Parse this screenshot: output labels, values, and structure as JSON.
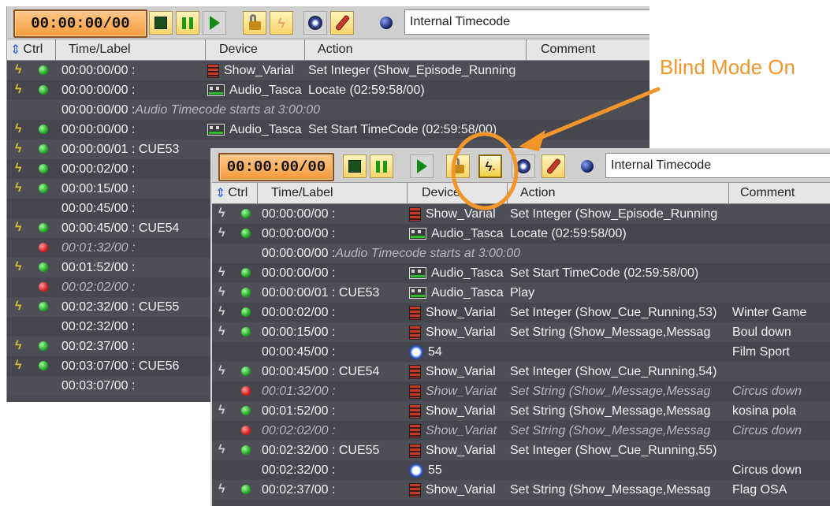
{
  "annotation": {
    "text": "Blind Mode On",
    "color": "#f2962a"
  },
  "toolbar": {
    "timecode": "00:00:00/00",
    "source": "Internal Timecode",
    "icons": [
      "stop-icon",
      "pause-icon",
      "play-icon",
      "lock-icon",
      "blind-mode-icon",
      "mixer-icon",
      "wrench-icon",
      "source-ball-icon"
    ]
  },
  "columns": {
    "ctrl": "Ctrl",
    "time": "Time/Label",
    "device": "Device",
    "action": "Action",
    "comment": "Comment"
  },
  "back_window": {
    "blind_mode": false,
    "rows": [
      {
        "bolt": true,
        "dot": "green",
        "time": "00:00:00/00 :",
        "icon": "show",
        "device": "Show_Varial",
        "action": "Set Integer (Show_Episode_Running",
        "comment": ""
      },
      {
        "bolt": true,
        "dot": "green",
        "time": "00:00:00/00 :",
        "icon": "audio",
        "device": "Audio_Tasca",
        "action": "Locate (02:59:58/00)",
        "comment": ""
      },
      {
        "bolt": false,
        "dot": "",
        "time": "00:00:00/00 : Audio Timecode starts at 3:00:00",
        "icon": "",
        "device": "",
        "action": "",
        "comment": "",
        "note": true
      },
      {
        "bolt": true,
        "dot": "green",
        "time": "00:00:00/00 :",
        "icon": "audio",
        "device": "Audio_Tasca",
        "action": "Set Start TimeCode (02:59:58/00)",
        "comment": ""
      },
      {
        "bolt": true,
        "dot": "green",
        "time": "00:00:00/01 : CUE53",
        "icon": "",
        "device": "",
        "action": "",
        "comment": ""
      },
      {
        "bolt": true,
        "dot": "green",
        "time": "00:00:02/00 :",
        "icon": "",
        "device": "",
        "action": "",
        "comment": ""
      },
      {
        "bolt": true,
        "dot": "green",
        "time": "00:00:15/00 :",
        "icon": "",
        "device": "",
        "action": "",
        "comment": ""
      },
      {
        "bolt": false,
        "dot": "",
        "time": "00:00:45/00 :",
        "icon": "",
        "device": "",
        "action": "",
        "comment": ""
      },
      {
        "bolt": true,
        "dot": "green",
        "time": "00:00:45/00 : CUE54",
        "icon": "",
        "device": "",
        "action": "",
        "comment": ""
      },
      {
        "bolt": false,
        "dot": "red",
        "time": "00:01:32/00 :",
        "icon": "",
        "device": "",
        "action": "",
        "comment": "",
        "disabled": true
      },
      {
        "bolt": true,
        "dot": "green",
        "time": "00:01:52/00 :",
        "icon": "",
        "device": "",
        "action": "",
        "comment": ""
      },
      {
        "bolt": false,
        "dot": "red",
        "time": "00:02:02/00 :",
        "icon": "",
        "device": "",
        "action": "",
        "comment": "",
        "disabled": true
      },
      {
        "bolt": true,
        "dot": "green",
        "time": "00:02:32/00 : CUE55",
        "icon": "",
        "device": "",
        "action": "",
        "comment": ""
      },
      {
        "bolt": false,
        "dot": "",
        "time": "00:02:32/00 :",
        "icon": "",
        "device": "",
        "action": "",
        "comment": ""
      },
      {
        "bolt": true,
        "dot": "green",
        "time": "00:02:37/00 :",
        "icon": "",
        "device": "",
        "action": "",
        "comment": ""
      },
      {
        "bolt": true,
        "dot": "green",
        "time": "00:03:07/00 : CUE56",
        "icon": "",
        "device": "",
        "action": "",
        "comment": ""
      },
      {
        "bolt": false,
        "dot": "",
        "time": "00:03:07/00 :",
        "icon": "",
        "device": "",
        "action": "",
        "comment": ""
      }
    ]
  },
  "front_window": {
    "blind_mode": true,
    "rows": [
      {
        "bolt": true,
        "dot": "green",
        "time": "00:00:00/00 :",
        "icon": "show",
        "device": "Show_Varial",
        "action": "Set Integer (Show_Episode_Running",
        "comment": ""
      },
      {
        "bolt": true,
        "dot": "green",
        "time": "00:00:00/00 :",
        "icon": "audio",
        "device": "Audio_Tasca",
        "action": "Locate (02:59:58/00)",
        "comment": ""
      },
      {
        "bolt": false,
        "dot": "",
        "time": "00:00:00/00 : Audio Timecode starts at 3:00:00",
        "icon": "",
        "device": "",
        "action": "",
        "comment": "",
        "note": true
      },
      {
        "bolt": true,
        "dot": "green",
        "time": "00:00:00/00 :",
        "icon": "audio",
        "device": "Audio_Tasca",
        "action": "Set Start TimeCode (02:59:58/00)",
        "comment": ""
      },
      {
        "bolt": true,
        "dot": "green",
        "time": "00:00:00/01 : CUE53",
        "icon": "audio",
        "device": "Audio_Tasca",
        "action": "Play",
        "comment": ""
      },
      {
        "bolt": true,
        "dot": "green",
        "time": "00:00:02/00 :",
        "icon": "show",
        "device": "Show_Varial",
        "action": "Set Integer (Show_Cue_Running,53)",
        "comment": "Winter Game"
      },
      {
        "bolt": true,
        "dot": "green",
        "time": "00:00:15/00 :",
        "icon": "show",
        "device": "Show_Varial",
        "action": "Set String (Show_Message,Messag",
        "comment": "Boul down"
      },
      {
        "bolt": false,
        "dot": "",
        "time": "00:00:45/00 :",
        "icon": "clock",
        "device": "54",
        "action": "",
        "comment": "Film Sport"
      },
      {
        "bolt": true,
        "dot": "green",
        "time": "00:00:45/00 : CUE54",
        "icon": "show",
        "device": "Show_Varial",
        "action": "Set Integer (Show_Cue_Running,54)",
        "comment": ""
      },
      {
        "bolt": false,
        "dot": "red",
        "time": "00:01:32/00 :",
        "icon": "show",
        "device": "Show_Variat",
        "action": "Set String (Show_Message,Messag",
        "comment": "Circus down",
        "disabled": true
      },
      {
        "bolt": true,
        "dot": "green",
        "time": "00:01:52/00 :",
        "icon": "show",
        "device": "Show_Varial",
        "action": "Set String (Show_Message,Messag",
        "comment": "kosina pola"
      },
      {
        "bolt": false,
        "dot": "red",
        "time": "00:02:02/00 :",
        "icon": "show",
        "device": "Show_Variat",
        "action": "Set String (Show_Message,Messag",
        "comment": "Circus down",
        "disabled": true
      },
      {
        "bolt": true,
        "dot": "green",
        "time": "00:02:32/00 : CUE55",
        "icon": "show",
        "device": "Show_Varial",
        "action": "Set Integer (Show_Cue_Running,55)",
        "comment": ""
      },
      {
        "bolt": false,
        "dot": "",
        "time": "00:02:32/00 :",
        "icon": "clock",
        "device": "55",
        "action": "",
        "comment": "Circus down"
      },
      {
        "bolt": true,
        "dot": "green",
        "time": "00:02:37/00 :",
        "icon": "show",
        "device": "Show_Varial",
        "action": "Set String (Show_Message,Messag",
        "comment": "Flag OSA"
      }
    ]
  }
}
